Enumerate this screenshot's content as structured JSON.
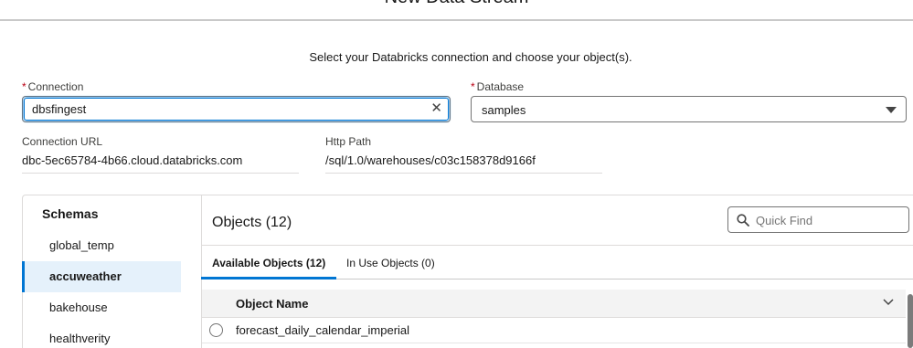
{
  "modal": {
    "title": "New Data Stream"
  },
  "instructions": "Select your Databricks connection and choose your object(s).",
  "connection": {
    "label": "Connection",
    "required_marker": "*",
    "value": "dbsfingest",
    "clear_glyph": "✕"
  },
  "database": {
    "label": "Database",
    "required_marker": "*",
    "value": "samples"
  },
  "connection_url": {
    "label": "Connection URL",
    "value": "dbc-5ec65784-4b66.cloud.databricks.com"
  },
  "http_path": {
    "label": "Http Path",
    "value": "/sql/1.0/warehouses/c03c158378d9166f"
  },
  "schemas": {
    "title": "Schemas",
    "items": [
      {
        "label": "global_temp",
        "active": false
      },
      {
        "label": "accuweather",
        "active": true
      },
      {
        "label": "bakehouse",
        "active": false
      },
      {
        "label": "healthverity",
        "active": false
      }
    ]
  },
  "objects": {
    "title": "Objects (12)",
    "search_placeholder": "Quick Find",
    "tabs": [
      {
        "label": "Available Objects (12)",
        "active": true
      },
      {
        "label": "In Use Objects (0)",
        "active": false
      }
    ],
    "column_header": "Object Name",
    "rows": [
      {
        "name": "forecast_daily_calendar_imperial",
        "selected": false
      }
    ]
  },
  "colors": {
    "accent": "#0176d3",
    "required": "#ba0517",
    "active_bg": "#e5f1fb"
  },
  "icons": {
    "clear": "close-icon",
    "caret": "caret-down-icon",
    "search": "search-icon",
    "chevron": "chevron-down-icon"
  }
}
